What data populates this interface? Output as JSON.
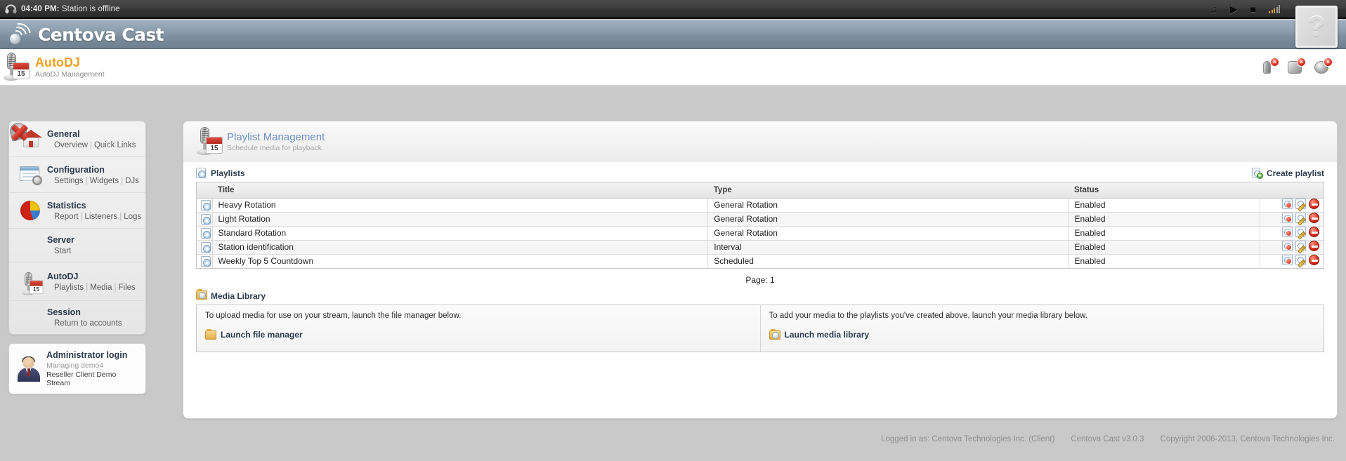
{
  "topbar": {
    "time": "04:40 PM:",
    "message": "Station is offline",
    "headphones_icon": "headphones-icon",
    "icons": [
      {
        "name": "music-note-icon",
        "glyph": "♫"
      },
      {
        "name": "play-icon",
        "glyph": "▶"
      },
      {
        "name": "stop-icon",
        "glyph": "■"
      }
    ],
    "signal_icon": "signal-bars-icon",
    "help_label": "?"
  },
  "brand": {
    "name": "Centova Cast",
    "logo_icon": "centova-waves-logo-icon"
  },
  "pagehead": {
    "title": "AutoDJ",
    "subtitle": "AutoDJ Management",
    "icon": "autodj-microphone-calendar-icon",
    "actions": [
      {
        "name": "stop-server-icon",
        "badge": "×"
      },
      {
        "name": "stop-autodj-icon",
        "badge": "×"
      },
      {
        "name": "stop-relay-icon",
        "badge": "×"
      }
    ]
  },
  "sidebar": {
    "items": [
      {
        "title": "General",
        "icon": "house-icon",
        "subs": [
          "Overview",
          "Quick Links"
        ]
      },
      {
        "title": "Configuration",
        "icon": "settings-window-icon",
        "subs": [
          "Settings",
          "Widgets",
          "DJs"
        ]
      },
      {
        "title": "Statistics",
        "icon": "pie-chart-icon",
        "subs": [
          "Report",
          "Listeners",
          "Logs"
        ]
      },
      {
        "title": "Server",
        "icon": "satellite-dish-icon",
        "subs": [
          "Start"
        ]
      },
      {
        "title": "AutoDJ",
        "icon": "microphone-calendar-icon",
        "subs": [
          "Playlists",
          "Media",
          "Files"
        ]
      },
      {
        "title": "Session",
        "icon": "red-x-icon",
        "subs": [
          "Return to accounts"
        ]
      }
    ],
    "admin": {
      "icon": "user-avatar-icon",
      "login": "Administrator login",
      "managing": "Managing demo4",
      "stream": "Reseller Client Demo Stream"
    }
  },
  "card": {
    "icon": "playlist-microphone-calendar-icon",
    "title": "Playlist Management",
    "subtitle": "Schedule media for playback"
  },
  "playlists_section": {
    "icon": "disc-icon",
    "label": "Playlists",
    "create": {
      "label": "Create playlist",
      "icon": "create-playlist-icon"
    },
    "columns": [
      "",
      "Title",
      "Type",
      "Status",
      ""
    ],
    "rows": [
      {
        "icon": "disc-icon",
        "title": "Heavy Rotation",
        "type": "General Rotation",
        "status": "Enabled"
      },
      {
        "icon": "disc-icon",
        "title": "Light Rotation",
        "type": "General Rotation",
        "status": "Enabled"
      },
      {
        "icon": "disc-icon",
        "title": "Standard Rotation",
        "type": "General Rotation",
        "status": "Enabled"
      },
      {
        "icon": "disc-icon",
        "title": "Station identification",
        "type": "Interval",
        "status": "Enabled"
      },
      {
        "icon": "disc-icon",
        "title": "Weekly Top 5 Countdown",
        "type": "Scheduled",
        "status": "Enabled"
      }
    ],
    "row_actions": [
      {
        "name": "manage-media-icon"
      },
      {
        "name": "edit-playlist-icon"
      },
      {
        "name": "delete-playlist-icon"
      }
    ],
    "pager": "Page: 1"
  },
  "media_library_section": {
    "icon": "media-library-folder-icon",
    "label": "Media Library",
    "columns": [
      {
        "blurb": "To upload media for use on your stream, launch the file manager below.",
        "link": "Launch file manager",
        "link_icon": "file-manager-icon"
      },
      {
        "blurb": "To add your media to the playlists you've created above, launch your media library below.",
        "link": "Launch media library",
        "link_icon": "media-library-icon"
      }
    ]
  },
  "footer": {
    "logged_in": "Logged in as: Centova Technologies Inc. (Client)",
    "version": "Centova Cast v3.0.3",
    "copyright": "Copyright 2006-2013, Centova Technologies Inc."
  },
  "colors": {
    "accent": "#f0a024",
    "brand_band": "#7c8e9e",
    "link": "#6e8fc0",
    "danger": "#cf2414"
  }
}
